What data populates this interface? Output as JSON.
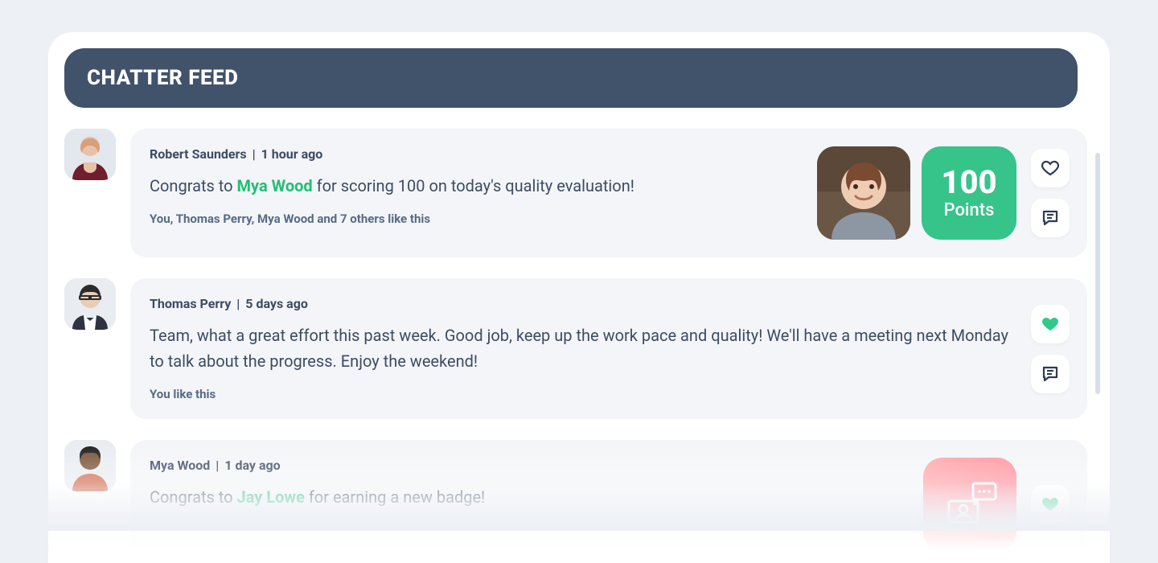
{
  "title": "CHATTER FEED",
  "posts": [
    {
      "author": "Robert Saunders",
      "time": "1 hour ago",
      "text_before": "Congrats to ",
      "mention": "Mya Wood",
      "text_after": " for scoring 100 on today's quality evaluation!",
      "likes": "You, Thomas Perry, Mya Wood and 7 others like this",
      "points_value": "100",
      "points_label": "Points",
      "liked": false
    },
    {
      "author": "Thomas Perry",
      "time": "5 days ago",
      "text": "Team, what a great effort this past week. Good job, keep up the work pace and quality! We'll have a meeting next Monday to talk about the progress. Enjoy the weekend!",
      "likes": "You like this",
      "liked": true
    },
    {
      "author": "Mya Wood",
      "time": "1 day ago",
      "text_before": "Congrats to ",
      "mention": "Jay Lowe",
      "text_after": " for earning a new badge!",
      "liked": true
    }
  ]
}
